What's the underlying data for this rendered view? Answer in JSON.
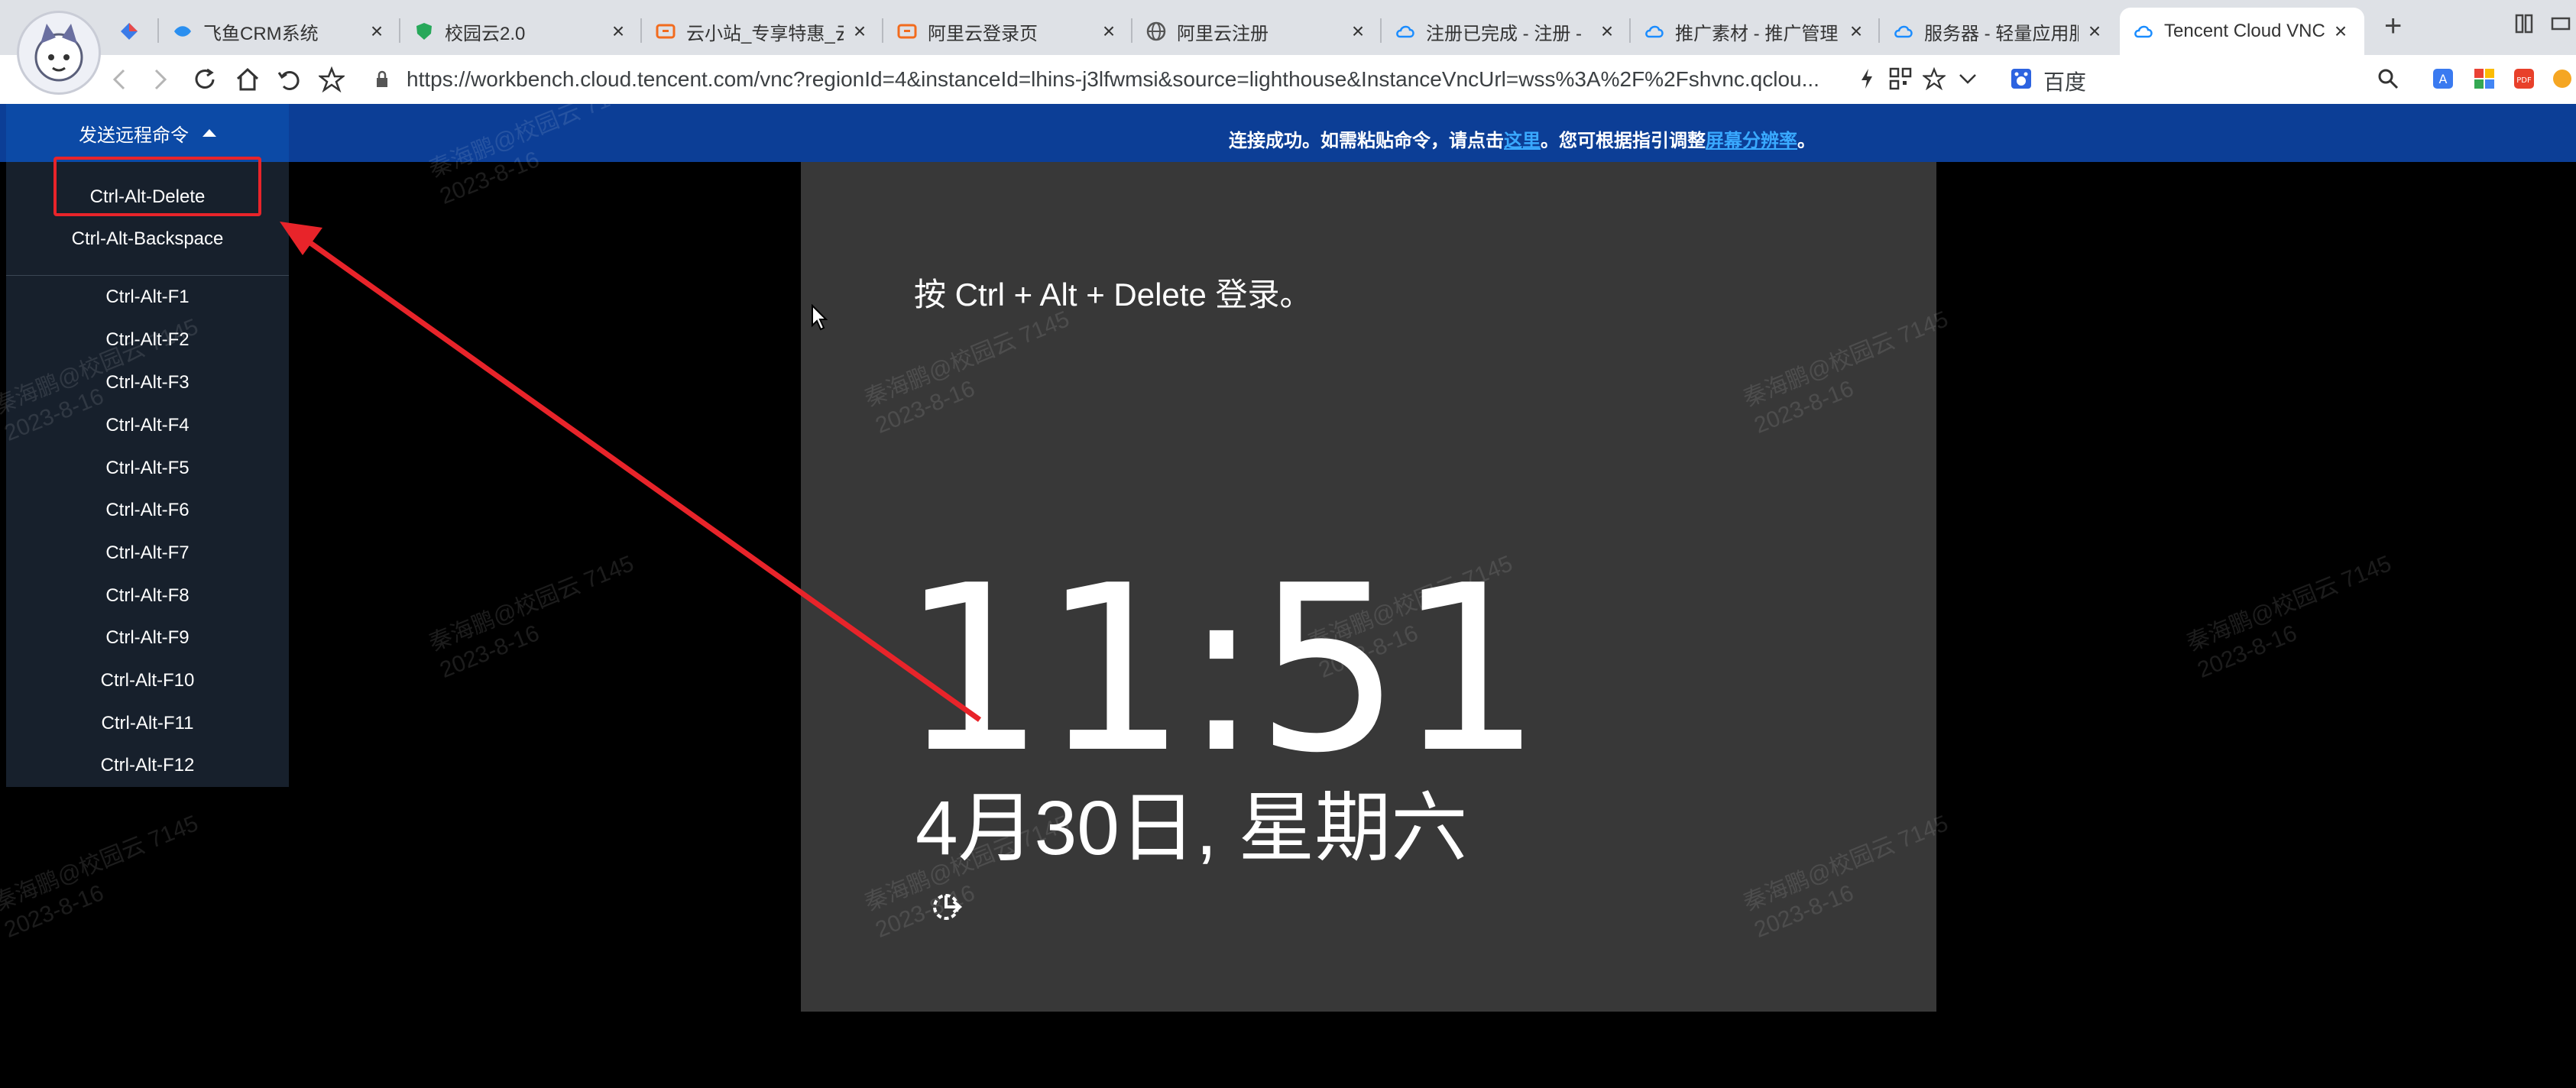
{
  "browser": {
    "tabs": [
      {
        "label": "",
        "icon": "kite-icon"
      },
      {
        "label": "飞鱼CRM系统",
        "icon": "fish-icon"
      },
      {
        "label": "校园云2.0",
        "icon": "shield-icon"
      },
      {
        "label": "云小站_专享特惠_云",
        "icon": "aliyun-icon"
      },
      {
        "label": "阿里云登录页",
        "icon": "aliyun-icon"
      },
      {
        "label": "阿里云注册",
        "icon": "globe-icon"
      },
      {
        "label": "注册已完成 - 注册 -",
        "icon": "tencent-cloud-icon"
      },
      {
        "label": "推广素材 - 推广管理",
        "icon": "tencent-cloud-icon"
      },
      {
        "label": "服务器 - 轻量应用服",
        "icon": "tencent-cloud-icon"
      },
      {
        "label": "Tencent Cloud VNC",
        "icon": "tencent-cloud-icon"
      }
    ],
    "new_tab": "+",
    "address": "https://workbench.cloud.tencent.com/vnc?regionId=4&instanceId=lhins-j3lfwmsi&source=lighthouse&InstanceVncUrl=wss%3A%2F%2Fshvnc.qclou...",
    "search_engine": "百度"
  },
  "vnc": {
    "menu_title": "发送远程命令",
    "commands": [
      "Ctrl-Alt-Delete",
      "Ctrl-Alt-Backspace",
      "Ctrl-Alt-F1",
      "Ctrl-Alt-F2",
      "Ctrl-Alt-F3",
      "Ctrl-Alt-F4",
      "Ctrl-Alt-F5",
      "Ctrl-Alt-F6",
      "Ctrl-Alt-F7",
      "Ctrl-Alt-F8",
      "Ctrl-Alt-F9",
      "Ctrl-Alt-F10",
      "Ctrl-Alt-F11",
      "Ctrl-Alt-F12"
    ],
    "status_msg": {
      "before": "连接成功。如需粘贴命令，请点击",
      "link1": "这里",
      "middle": "。您可根据指引调整",
      "link2": "屏幕分辨率",
      "after": "。"
    }
  },
  "lockscreen": {
    "prompt": "按 Ctrl + Alt + Delete 登录。",
    "time": "11:51",
    "date": "4月30日, 星期六"
  },
  "watermark": {
    "line1": "秦海鹏@校园云 7145",
    "line2": "2023-8-16"
  },
  "colors": {
    "vnc_header": "#0c3e96",
    "menu_bg": "#17202c",
    "lock_bg": "#383838",
    "annotation_red": "#e8242a"
  }
}
